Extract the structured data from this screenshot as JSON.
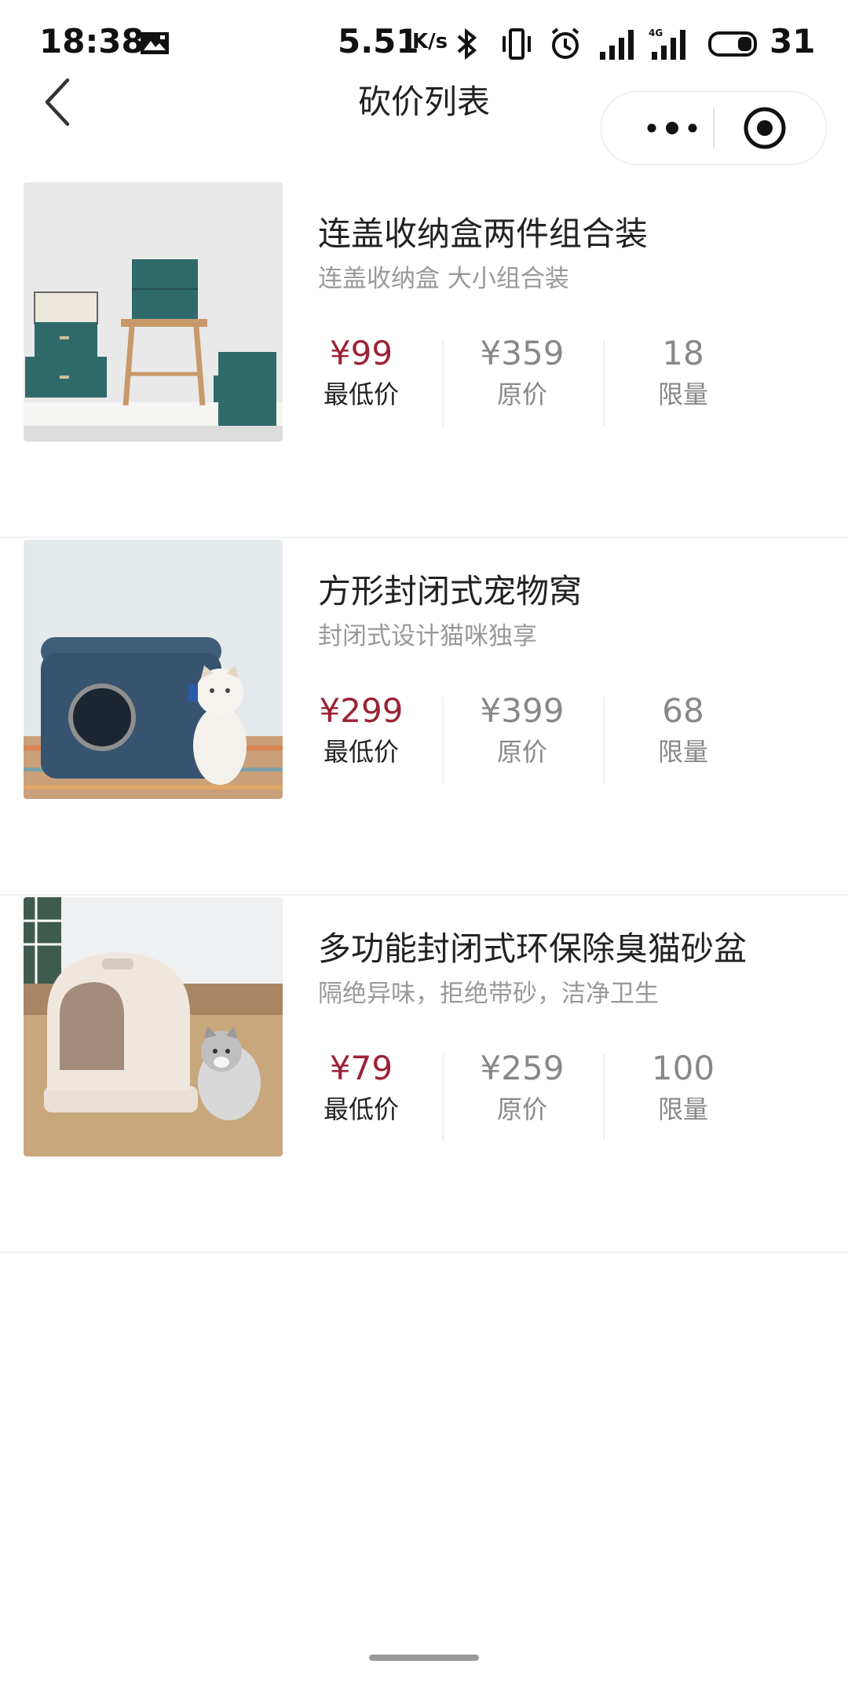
{
  "status": {
    "time": "18:38",
    "net_speed": "5.51",
    "net_unit": "K/s",
    "battery": "31",
    "icons": [
      "image-icon",
      "bluetooth-icon",
      "vibrate-icon",
      "alarm-icon",
      "signal-icon",
      "signal-4g-icon",
      "battery-icon"
    ]
  },
  "nav": {
    "title": "砍价列表"
  },
  "products": [
    {
      "title": "连盖收纳盒两件组合装",
      "subtitle": "连盖收纳盒 大小组合装",
      "low_price": "¥99",
      "low_label": "最低价",
      "orig_price": "¥359",
      "orig_label": "原价",
      "limit": "18",
      "limit_label": "限量"
    },
    {
      "title": "方形封闭式宠物窝",
      "subtitle": "封闭式设计猫咪独享",
      "low_price": "¥299",
      "low_label": "最低价",
      "orig_price": "¥399",
      "orig_label": "原价",
      "limit": "68",
      "limit_label": "限量"
    },
    {
      "title": "多功能封闭式环保除臭猫砂盆",
      "subtitle": "隔绝异味，拒绝带砂，洁净卫生",
      "low_price": "¥79",
      "low_label": "最低价",
      "orig_price": "¥259",
      "orig_label": "原价",
      "limit": "100",
      "limit_label": "限量"
    }
  ],
  "colors": {
    "accent": "#9b2335",
    "muted": "#888888"
  }
}
